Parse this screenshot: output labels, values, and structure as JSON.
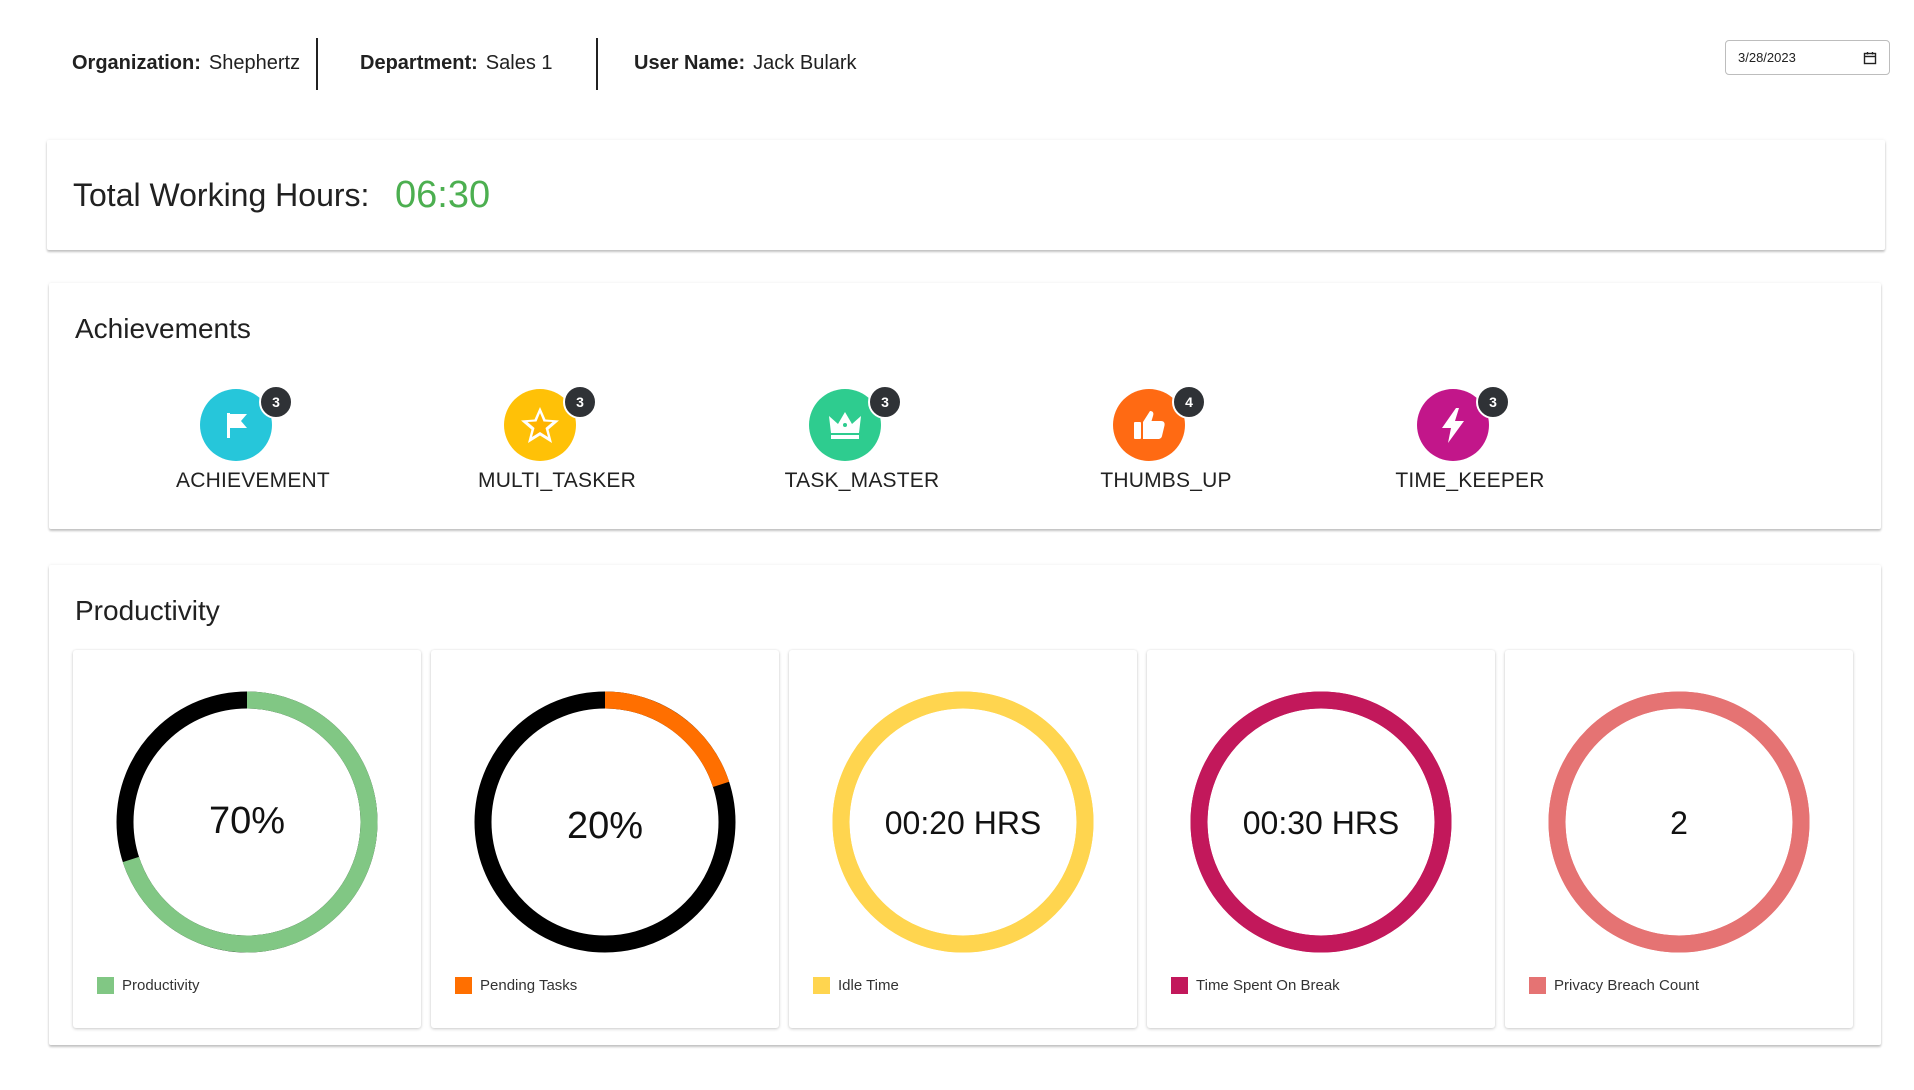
{
  "header": {
    "organization_label": "Organization:",
    "organization_value": "Shephertz",
    "department_label": "Department:",
    "department_value": "Sales 1",
    "username_label": "User Name:",
    "username_value": "Jack Bulark",
    "date_value": "3/28/2023",
    "calendar_icon": "calendar-icon"
  },
  "working_hours": {
    "label": "Total Working Hours:",
    "value": "06:30",
    "value_color": "#4caf50"
  },
  "achievements": {
    "title": "Achievements",
    "items": [
      {
        "name": "ACHIEVEMENT",
        "count": "3",
        "icon": "flag-icon",
        "color": "#26c6da"
      },
      {
        "name": "MULTI_TASKER",
        "count": "3",
        "icon": "star-icon",
        "color": "#ffc107"
      },
      {
        "name": "TASK_MASTER",
        "count": "3",
        "icon": "crown-icon",
        "color": "#2ecc8f"
      },
      {
        "name": "THUMBS_UP",
        "count": "4",
        "icon": "thumbs-up-icon",
        "color": "#ff6a13"
      },
      {
        "name": "TIME_KEEPER",
        "count": "3",
        "icon": "lightning-icon",
        "color": "#c2168a"
      }
    ]
  },
  "productivity": {
    "title": "Productivity",
    "metrics": [
      {
        "value": "70%",
        "legend": "Productivity",
        "color": "#81c784",
        "track": "#000000",
        "fraction": 0.7
      },
      {
        "value": "20%",
        "legend": "Pending Tasks",
        "color": "#ff6f00",
        "track": "#000000",
        "fraction": 0.2
      },
      {
        "value": "00:20 HRS",
        "legend": "Idle Time",
        "color": "#ffd54f",
        "track": "#ffd54f",
        "fraction": 1
      },
      {
        "value": "00:30 HRS",
        "legend": "Time Spent On Break",
        "color": "#c2185b",
        "track": "#c2185b",
        "fraction": 1
      },
      {
        "value": "2",
        "legend": "Privacy Breach Count",
        "color": "#e57373",
        "track": "#e57373",
        "fraction": 1
      }
    ]
  }
}
